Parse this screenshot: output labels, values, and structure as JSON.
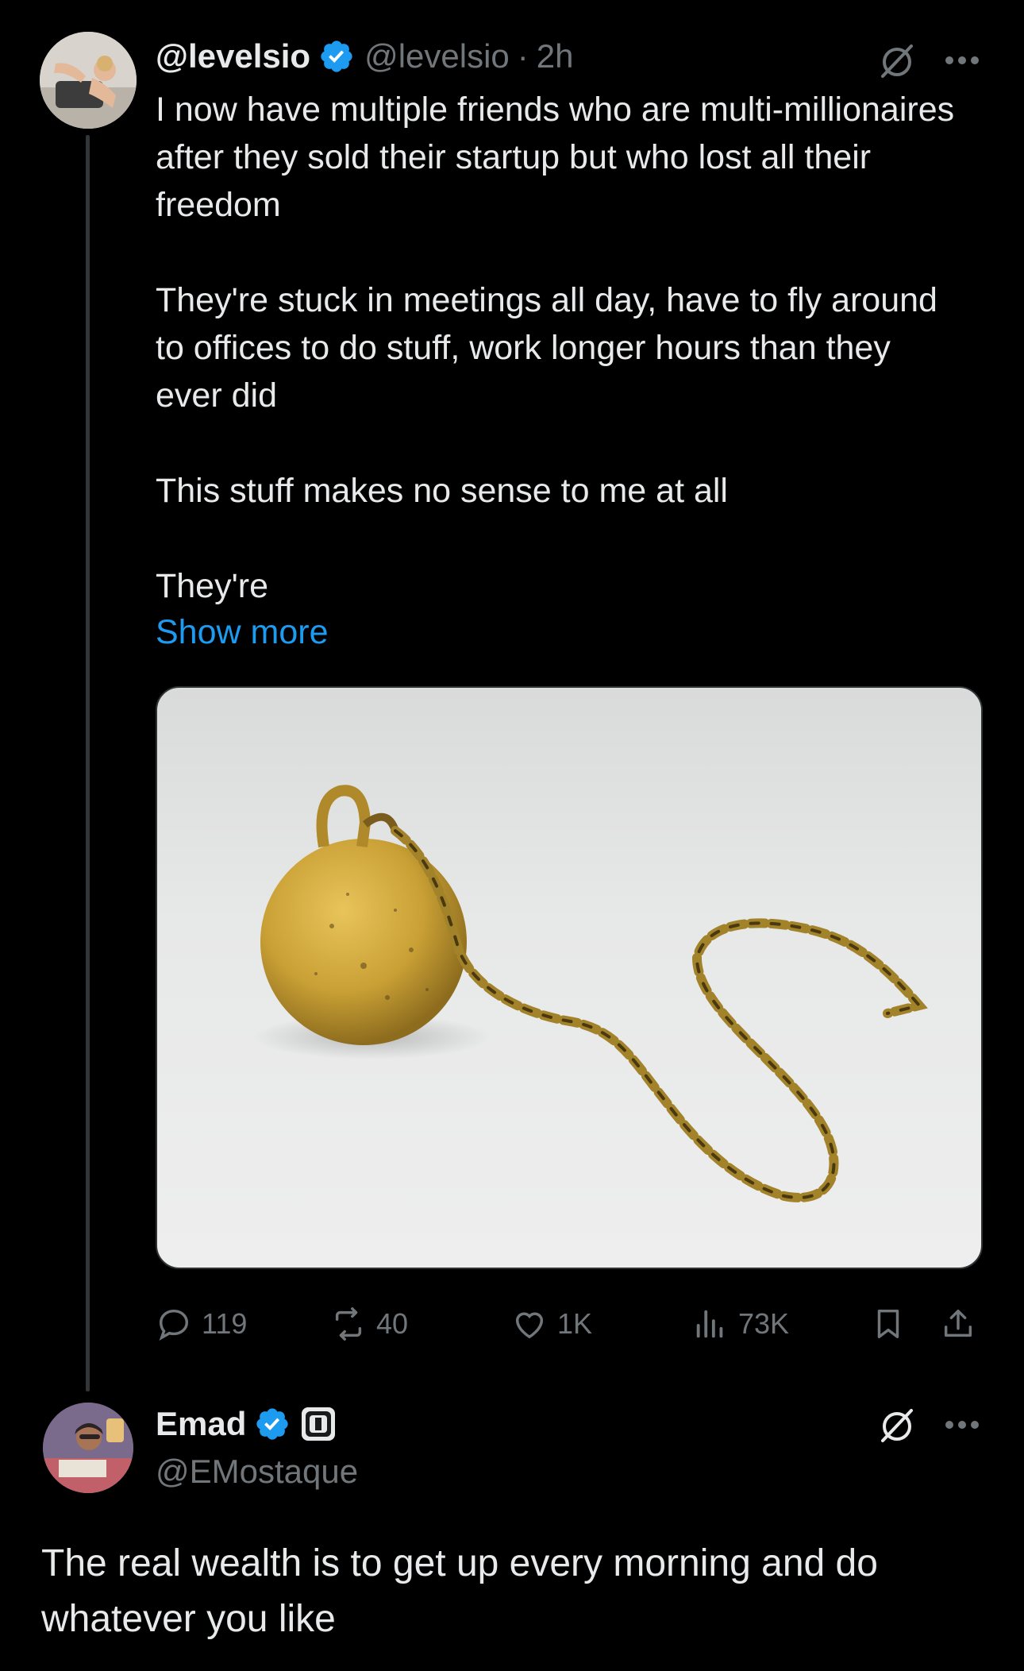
{
  "tweet": {
    "author_name": "@levelsio",
    "author_handle": "@levelsio",
    "time": "2h",
    "separator": "·",
    "paragraphs": [
      "I now have multiple friends who are multi-millionaires after they sold their startup but who lost all their freedom",
      "They're stuck in meetings all day, have to fly around to offices to do stuff, work longer hours than they ever did",
      "This stuff makes no sense to me at all",
      "They're"
    ],
    "show_more": "Show more",
    "stats": {
      "replies": "119",
      "reposts": "40",
      "likes": "1K",
      "views": "73K"
    }
  },
  "reply": {
    "author_name": "Emad",
    "author_handle": "@EMostaque",
    "text": "The real wealth is to get up every morning and do whatever you like"
  },
  "icons": {
    "verified": "verified-badge-icon",
    "grok": "grok-icon",
    "more": "more-icon",
    "reply": "reply-icon",
    "repost": "repost-icon",
    "like": "like-icon",
    "views": "views-icon",
    "bookmark": "bookmark-icon",
    "share": "share-icon",
    "affiliate": "affiliate-badge-icon"
  },
  "colors": {
    "background": "#000000",
    "text": "#e7e9ea",
    "muted": "#71767b",
    "link": "#1d9bf0",
    "verified": "#1d9bf0"
  }
}
